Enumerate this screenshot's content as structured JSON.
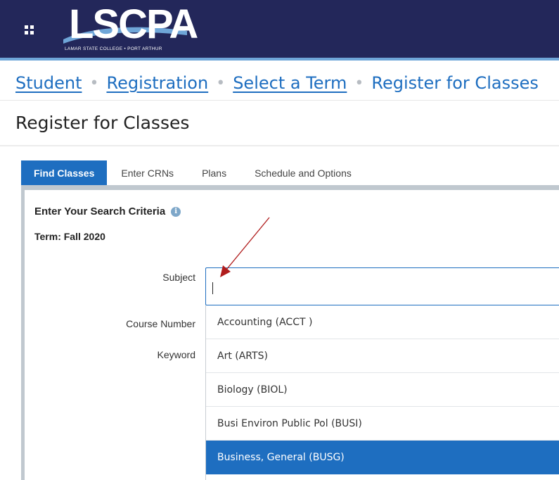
{
  "header": {
    "logo_text": "LSCPA",
    "logo_subtitle": "LAMAR STATE COLLEGE • PORT ARTHUR"
  },
  "breadcrumb": [
    {
      "label": "Student",
      "link": true
    },
    {
      "label": "Registration",
      "link": true
    },
    {
      "label": "Select a Term",
      "link": true
    },
    {
      "label": "Register for Classes",
      "link": false
    }
  ],
  "breadcrumb_separator": "•",
  "page_title": "Register for Classes",
  "tabs": [
    {
      "label": "Find Classes",
      "active": true
    },
    {
      "label": "Enter CRNs",
      "active": false
    },
    {
      "label": "Plans",
      "active": false
    },
    {
      "label": "Schedule and Options",
      "active": false
    }
  ],
  "search": {
    "heading": "Enter Your Search Criteria",
    "info_icon": "i",
    "term": "Term: Fall 2020",
    "subject_label": "Subject",
    "course_number_label": "Course Number",
    "keyword_label": "Keyword",
    "subject_value": ""
  },
  "subject_options": [
    {
      "label": "Accounting (ACCT )",
      "selected": false
    },
    {
      "label": "Art (ARTS)",
      "selected": false
    },
    {
      "label": "Biology (BIOL)",
      "selected": false
    },
    {
      "label": "Busi Environ Public Pol (BUSI)",
      "selected": false
    },
    {
      "label": "Business, General (BUSG)",
      "selected": true
    }
  ],
  "colors": {
    "header_bg": "#23275a",
    "accent": "#1e6ec0",
    "arrow": "#b01c1c"
  }
}
